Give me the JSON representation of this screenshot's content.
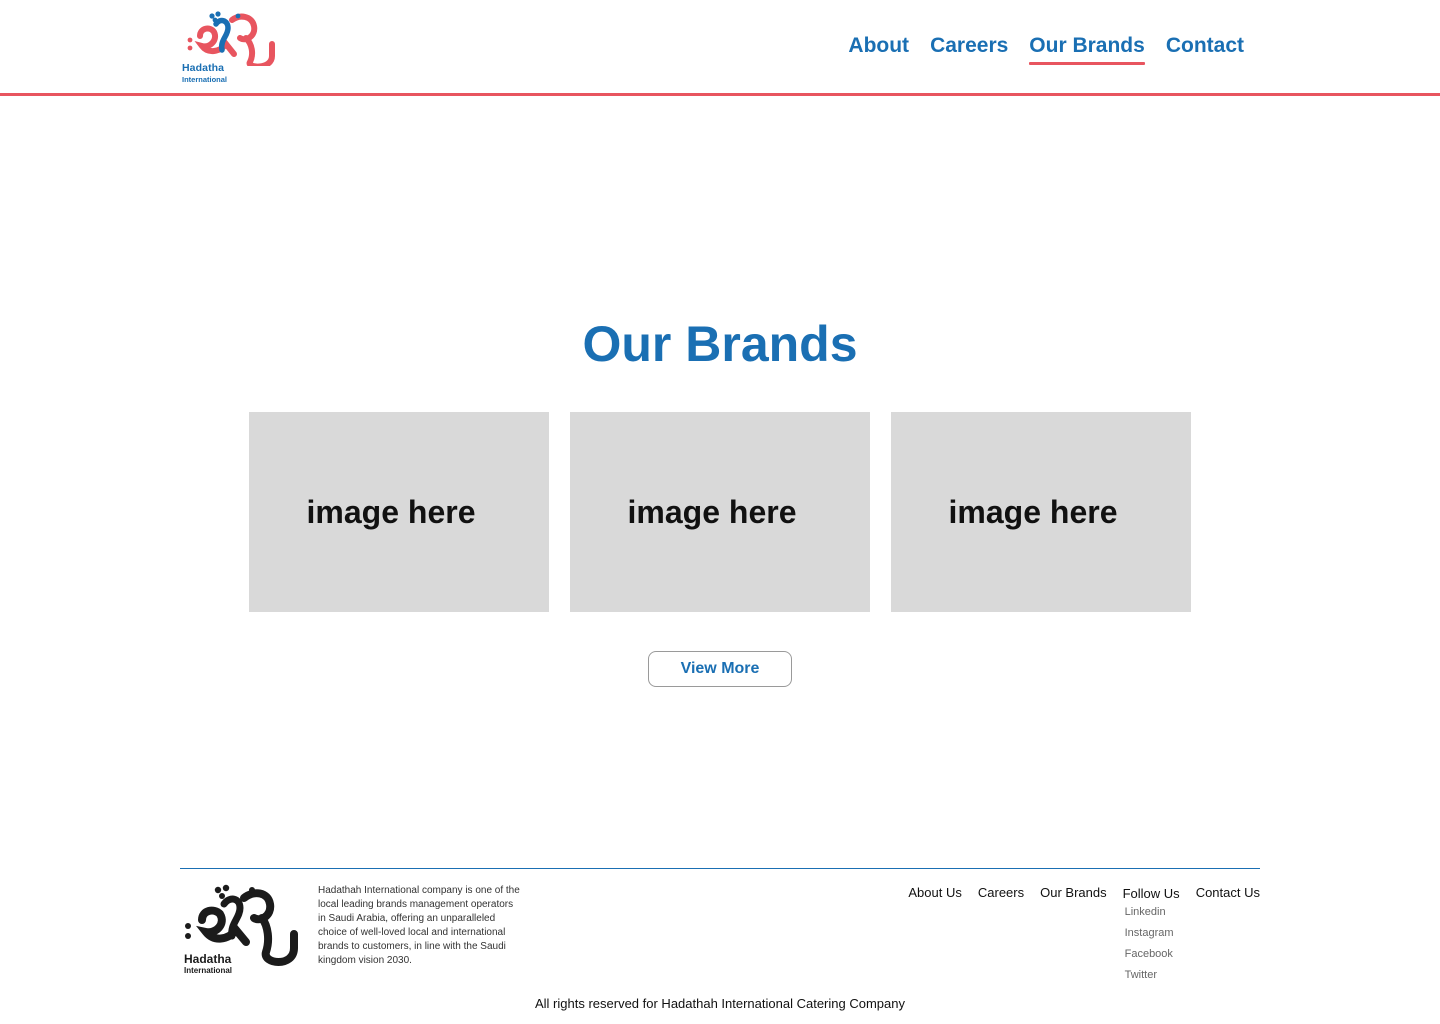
{
  "header": {
    "logo": {
      "name": "Hadatha",
      "subname": "International"
    },
    "nav": [
      {
        "label": "About",
        "active": false
      },
      {
        "label": "Careers",
        "active": false
      },
      {
        "label": "Our Brands",
        "active": true
      },
      {
        "label": "Contact",
        "active": false
      }
    ]
  },
  "main": {
    "title": "Our Brands",
    "cards": [
      {
        "label": "image here"
      },
      {
        "label": "image here"
      },
      {
        "label": "image here"
      }
    ],
    "view_more_label": "View More"
  },
  "footer": {
    "logo": {
      "name": "Hadatha",
      "subname": "International"
    },
    "description": "Hadathah International company is one of the local leading brands management operators in Saudi Arabia, offering an unparalleled choice of well-loved local and international brands to customers, in line with the Saudi kingdom vision 2030.",
    "links": {
      "about": "About Us",
      "careers": "Careers",
      "brands": "Our Brands",
      "follow": "Follow Us",
      "contact": "Contact Us"
    },
    "social": [
      "Linkedin",
      "Instagram",
      "Facebook",
      "Twitter"
    ],
    "copyright": "All rights reserved for Hadathah International Catering Company"
  },
  "colors": {
    "brand_blue": "#1a6fb3",
    "brand_red": "#e8555f",
    "placeholder_gray": "#d9d9d9"
  }
}
